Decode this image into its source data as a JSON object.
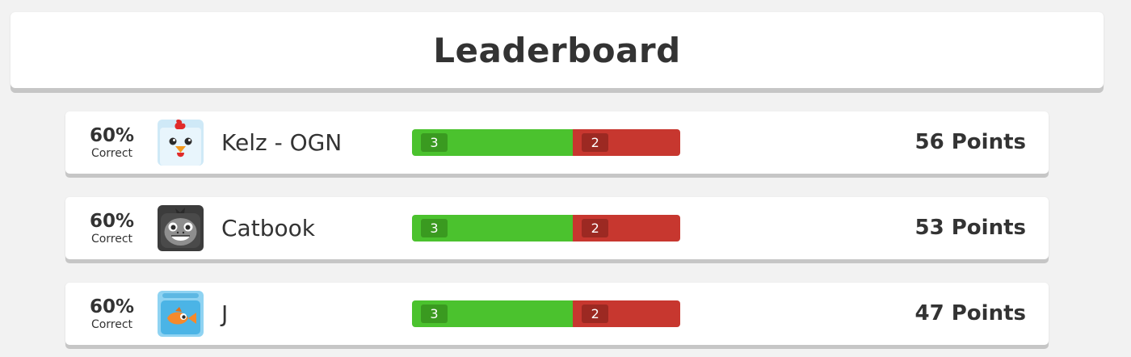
{
  "header": {
    "title": "Leaderboard"
  },
  "colors": {
    "correct": "#4bc22e",
    "incorrect": "#c7372f",
    "card_bg": "#ffffff",
    "page_bg": "#f2f2f2",
    "text": "#333333"
  },
  "rows": [
    {
      "percent": "60%",
      "percent_label": "Correct",
      "avatar_icon": "chicken-icon",
      "name": "Kelz - OGN",
      "correct_count": "3",
      "incorrect_count": "2",
      "correct_fraction": 0.6,
      "points": "56 Points"
    },
    {
      "percent": "60%",
      "percent_label": "Correct",
      "avatar_icon": "gorilla-icon",
      "name": "Catbook",
      "correct_count": "3",
      "incorrect_count": "2",
      "correct_fraction": 0.6,
      "points": "53 Points"
    },
    {
      "percent": "60%",
      "percent_label": "Correct",
      "avatar_icon": "goldfish-icon",
      "name": "J",
      "correct_count": "3",
      "incorrect_count": "2",
      "correct_fraction": 0.6,
      "points": "47 Points"
    }
  ]
}
